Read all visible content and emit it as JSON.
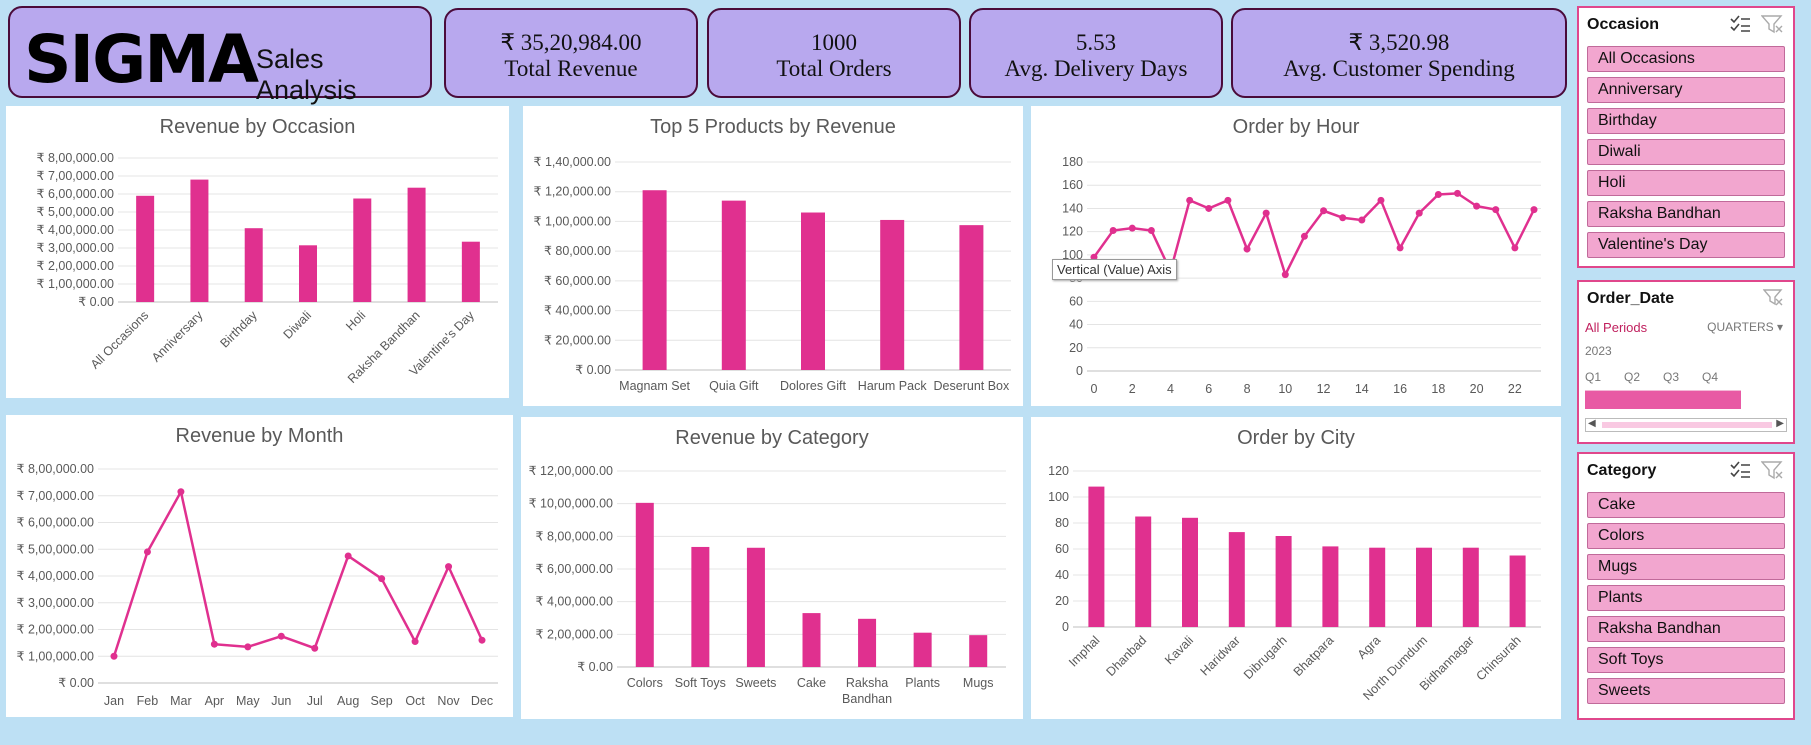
{
  "logo": {
    "text": "SIGMA",
    "subtitle": "Sales Analysis"
  },
  "kpis": [
    {
      "value": "₹ 35,20,984.00",
      "label": "Total  Revenue"
    },
    {
      "value": "1000",
      "label": "Total Orders"
    },
    {
      "value": "5.53",
      "label": "Avg. Delivery Days"
    },
    {
      "value": "₹ 3,520.98",
      "label": "Avg. Customer Spending"
    }
  ],
  "colors": {
    "accent": "#e0308f",
    "kpi_bg": "#b8a8ee",
    "background": "#bde0f4"
  },
  "tooltip": "Vertical (Value) Axis",
  "chart_data": [
    {
      "id": "occasion",
      "type": "bar",
      "title": "Revenue by Occasion",
      "categories": [
        "All Occasions",
        "Anniversary",
        "Birthday",
        "Diwali",
        "Holi",
        "Raksha Bandhan",
        "Valentine's Day"
      ],
      "values": [
        590000,
        680000,
        410000,
        315000,
        575000,
        635000,
        335000
      ],
      "ylim": [
        0,
        800000
      ],
      "yticks": [
        "₹ 0.00",
        "₹ 1,00,000.00",
        "₹ 2,00,000.00",
        "₹ 3,00,000.00",
        "₹ 4,00,000.00",
        "₹ 5,00,000.00",
        "₹ 6,00,000.00",
        "₹ 7,00,000.00",
        "₹ 8,00,000.00"
      ]
    },
    {
      "id": "top5",
      "type": "bar",
      "title": "Top 5 Products by Revenue",
      "categories": [
        "Magnam Set",
        "Quia Gift",
        "Dolores Gift",
        "Harum Pack",
        "Deserunt Box"
      ],
      "values": [
        121000,
        114000,
        106000,
        101000,
        97500
      ],
      "ylim": [
        0,
        140000
      ],
      "yticks": [
        "₹ 0.00",
        "₹ 20,000.00",
        "₹ 40,000.00",
        "₹ 60,000.00",
        "₹ 80,000.00",
        "₹ 1,00,000.00",
        "₹ 1,20,000.00",
        "₹ 1,40,000.00"
      ]
    },
    {
      "id": "hour",
      "type": "line",
      "title": "Order by Hour",
      "x": [
        0,
        1,
        2,
        3,
        4,
        5,
        6,
        7,
        8,
        9,
        10,
        11,
        12,
        13,
        14,
        15,
        16,
        17,
        18,
        19,
        20,
        21,
        22,
        23
      ],
      "values": [
        98,
        121,
        123,
        121,
        86,
        147,
        140,
        147,
        105,
        136,
        83,
        116,
        138,
        132,
        130,
        147,
        106,
        136,
        152,
        153,
        142,
        139,
        106,
        139
      ],
      "ylim": [
        0,
        180
      ],
      "yticks": [
        "0",
        "20",
        "40",
        "60",
        "80",
        "100",
        "120",
        "140",
        "160",
        "180"
      ],
      "xticks": [
        "0",
        "2",
        "4",
        "6",
        "8",
        "10",
        "12",
        "14",
        "16",
        "18",
        "20",
        "22"
      ]
    },
    {
      "id": "month",
      "type": "line",
      "title": "Revenue by Month",
      "categories": [
        "Jan",
        "Feb",
        "Mar",
        "Apr",
        "May",
        "Jun",
        "Jul",
        "Aug",
        "Sep",
        "Oct",
        "Nov",
        "Dec"
      ],
      "values": [
        100000,
        490000,
        715000,
        145000,
        135000,
        175000,
        130000,
        475000,
        390000,
        155000,
        435000,
        160000
      ],
      "ylim": [
        0,
        800000
      ],
      "yticks": [
        "₹ 0.00",
        "₹ 1,00,000.00",
        "₹ 2,00,000.00",
        "₹ 3,00,000.00",
        "₹ 4,00,000.00",
        "₹ 5,00,000.00",
        "₹ 6,00,000.00",
        "₹ 7,00,000.00",
        "₹ 8,00,000.00"
      ]
    },
    {
      "id": "category",
      "type": "bar",
      "title": "Revenue by Category",
      "categories": [
        "Colors",
        "Soft Toys",
        "Sweets",
        "Cake",
        "Raksha Bandhan",
        "Plants",
        "Mugs"
      ],
      "values": [
        1005000,
        735000,
        730000,
        330000,
        295000,
        210000,
        195000
      ],
      "ylim": [
        0,
        1200000
      ],
      "yticks": [
        "₹ 0.00",
        "₹ 2,00,000.00",
        "₹ 4,00,000.00",
        "₹ 6,00,000.00",
        "₹ 8,00,000.00",
        "₹ 10,00,000.00",
        "₹ 12,00,000.00"
      ]
    },
    {
      "id": "city",
      "type": "bar",
      "title": "Order by City",
      "categories": [
        "Imphal",
        "Dhanbad",
        "Kavali",
        "Haridwar",
        "Dibrugarh",
        "Bhatpara",
        "Agra",
        "North Dumdum",
        "Bidhannagar",
        "Chinsurah"
      ],
      "values": [
        108,
        85,
        84,
        73,
        70,
        62,
        61,
        61,
        61,
        55
      ],
      "ylim": [
        0,
        120
      ],
      "yticks": [
        "0",
        "20",
        "40",
        "60",
        "80",
        "100",
        "120"
      ]
    }
  ],
  "slicers": {
    "occasion": {
      "title": "Occasion",
      "items": [
        "All Occasions",
        "Anniversary",
        "Birthday",
        "Diwali",
        "Holi",
        "Raksha Bandhan",
        "Valentine's Day"
      ]
    },
    "order_date": {
      "title": "Order_Date",
      "period": "All Periods",
      "level": "QUARTERS",
      "year": "2023",
      "quarters": [
        "Q1",
        "Q2",
        "Q3",
        "Q4"
      ]
    },
    "category": {
      "title": "Category",
      "items": [
        "Cake",
        "Colors",
        "Mugs",
        "Plants",
        "Raksha Bandhan",
        "Soft Toys",
        "Sweets"
      ]
    }
  }
}
